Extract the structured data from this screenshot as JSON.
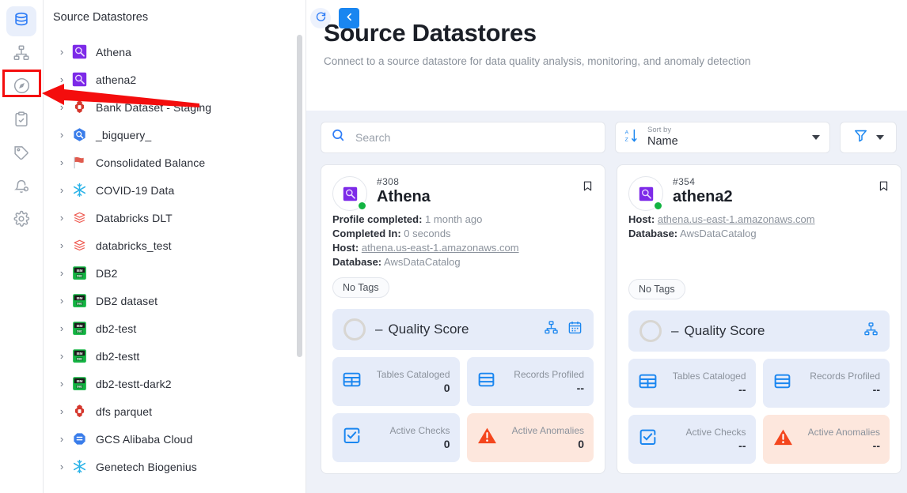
{
  "rail": {
    "items": [
      {
        "name": "datastores",
        "icon": "database-icon",
        "active": true
      },
      {
        "name": "lineage",
        "icon": "sitemap-icon",
        "active": false
      },
      {
        "name": "explore",
        "icon": "compass-icon",
        "active": false
      },
      {
        "name": "checks",
        "icon": "clipboard-check-icon",
        "active": false
      },
      {
        "name": "tags",
        "icon": "tag-icon",
        "active": false
      },
      {
        "name": "notifications",
        "icon": "bell-settings-icon",
        "active": false
      },
      {
        "name": "settings",
        "icon": "gear-icon",
        "active": false
      }
    ]
  },
  "tree": {
    "header": "Source Datastores",
    "items": [
      {
        "label": "Athena",
        "icon": "athena-icon"
      },
      {
        "label": "athena2",
        "icon": "athena-icon"
      },
      {
        "label": "Bank Dataset - Staging",
        "icon": "drill-icon"
      },
      {
        "label": "_bigquery_",
        "icon": "bigquery-icon"
      },
      {
        "label": "Consolidated Balance",
        "icon": "flag-icon"
      },
      {
        "label": "COVID-19 Data",
        "icon": "snowflake-icon"
      },
      {
        "label": "Databricks DLT",
        "icon": "databricks-icon"
      },
      {
        "label": "databricks_test",
        "icon": "databricks-icon"
      },
      {
        "label": "DB2",
        "icon": "db2-icon"
      },
      {
        "label": "DB2 dataset",
        "icon": "db2-icon"
      },
      {
        "label": "db2-test",
        "icon": "db2-icon"
      },
      {
        "label": "db2-testt",
        "icon": "db2-icon"
      },
      {
        "label": "db2-testt-dark2",
        "icon": "db2-icon"
      },
      {
        "label": "dfs parquet",
        "icon": "drill-icon"
      },
      {
        "label": "GCS Alibaba Cloud",
        "icon": "gcs-icon"
      },
      {
        "label": "Genetech Biogenius",
        "icon": "snowflake-icon"
      }
    ],
    "expand_chevron": "›"
  },
  "header": {
    "refresh_icon": "refresh-icon",
    "back_icon": "chevron-left-icon",
    "title": "Source Datastores",
    "subtitle": "Connect to a source datastore for data quality analysis, monitoring, and anomaly detection"
  },
  "toolbar": {
    "search": {
      "placeholder": "Search",
      "value": "",
      "icon": "search-icon"
    },
    "sort": {
      "icon": "sort-az-icon",
      "label": "Sort by",
      "value": "Name"
    },
    "filter": {
      "icon": "filter-funnel-icon"
    }
  },
  "cards": [
    {
      "id": "#308",
      "name": "Athena",
      "icon": "athena-icon",
      "status": "online",
      "bookmark_icon": "bookmark-icon",
      "details": [
        {
          "key": "Profile completed:",
          "value": "1 month ago",
          "link": false
        },
        {
          "key": "Completed In:",
          "value": "0 seconds",
          "link": false
        },
        {
          "key": "Host:",
          "value": "athena.us-east-1.amazonaws.com",
          "link": true
        },
        {
          "key": "Database:",
          "value": "AwsDataCatalog",
          "link": false
        }
      ],
      "tag": "No Tags",
      "quality": {
        "value": "–",
        "label": "Quality Score",
        "icons": [
          "sitemap-icon",
          "calendar-icon"
        ]
      },
      "metrics": [
        {
          "label": "Tables Cataloged",
          "value": "0",
          "icon": "table-icon",
          "warn": false
        },
        {
          "label": "Records Profiled",
          "value": "--",
          "icon": "records-icon",
          "warn": false
        },
        {
          "label": "Active Checks",
          "value": "0",
          "icon": "check-square-icon",
          "warn": false
        },
        {
          "label": "Active Anomalies",
          "value": "0",
          "icon": "warning-triangle-icon",
          "warn": true
        }
      ]
    },
    {
      "id": "#354",
      "name": "athena2",
      "icon": "athena-icon",
      "status": "online",
      "bookmark_icon": "bookmark-icon",
      "details": [
        {
          "key": "Host:",
          "value": "athena.us-east-1.amazonaws.com",
          "link": true
        },
        {
          "key": "Database:",
          "value": "AwsDataCatalog",
          "link": false
        }
      ],
      "tag": "No Tags",
      "quality": {
        "value": "–",
        "label": "Quality Score",
        "icons": [
          "sitemap-icon"
        ]
      },
      "metrics": [
        {
          "label": "Tables Cataloged",
          "value": "--",
          "icon": "table-icon",
          "warn": false
        },
        {
          "label": "Records Profiled",
          "value": "--",
          "icon": "records-icon",
          "warn": false
        },
        {
          "label": "Active Checks",
          "value": "--",
          "icon": "check-square-icon",
          "warn": false
        },
        {
          "label": "Active Anomalies",
          "value": "--",
          "icon": "warning-triangle-icon",
          "warn": true
        }
      ]
    }
  ],
  "annotation": {
    "box_color": "#f40d0d",
    "arrow_color": "#f40d0d",
    "target": "compass-icon"
  },
  "colors": {
    "accent": "#1a86f0",
    "panel": "#e6ecf9",
    "warn": "#fde7dd",
    "online": "#12b341"
  }
}
